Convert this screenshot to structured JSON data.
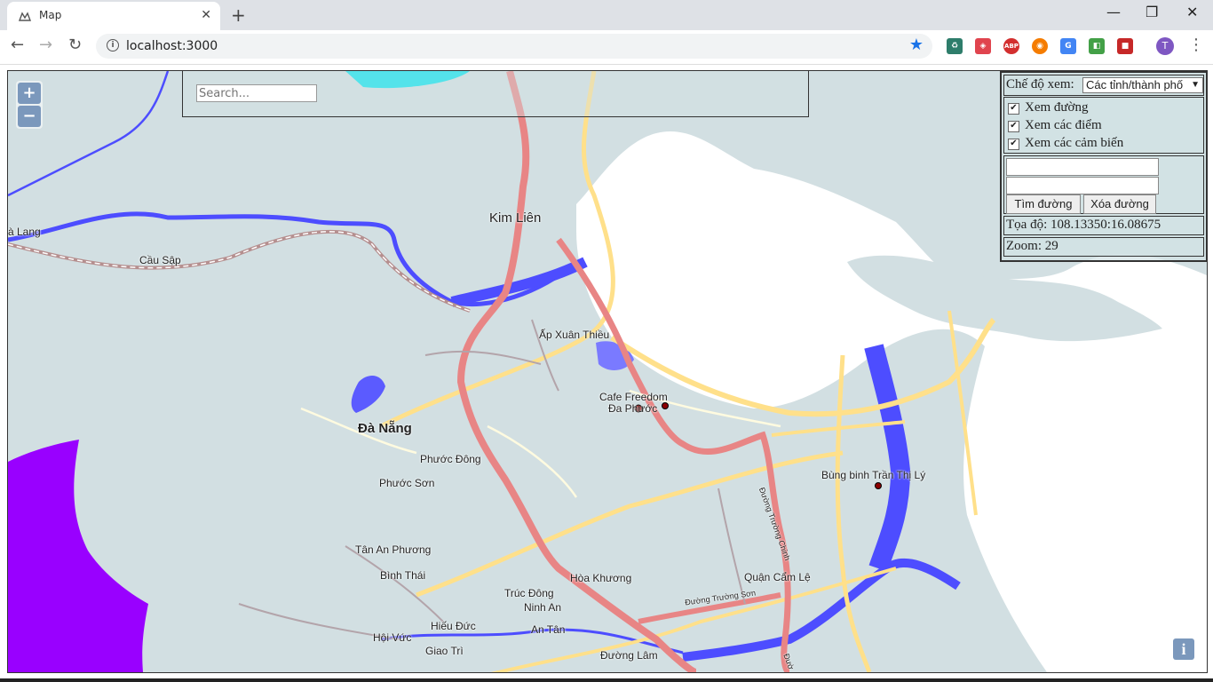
{
  "browser": {
    "tab_title": "Map",
    "tab_close": "✕",
    "new_tab": "+",
    "url": "localhost:3000",
    "avatar_letter": "T",
    "window_controls": {
      "minimize": "—",
      "maximize": "❐",
      "close": "✕"
    },
    "nav": {
      "back": "←",
      "forward": "→",
      "reload": "↻"
    },
    "extensions": [
      {
        "name": "recycle-icon",
        "color": "#2e7d6b",
        "text": "♻"
      },
      {
        "name": "shield-icon",
        "color": "#e0444e",
        "text": "◈"
      },
      {
        "name": "abp-icon",
        "color": "#d32f2f",
        "text": "ABP"
      },
      {
        "name": "orange-extension-icon",
        "color": "#f57c00",
        "text": "◉"
      },
      {
        "name": "translate-icon",
        "color": "#4285f4",
        "text": "G"
      },
      {
        "name": "green-extension-icon",
        "color": "#43a047",
        "text": "◧"
      },
      {
        "name": "red-extension-icon",
        "color": "#c62828",
        "text": "■"
      }
    ]
  },
  "map": {
    "zoom_in": "+",
    "zoom_out": "−",
    "search_placeholder": "Search...",
    "info_button": "i",
    "labels": {
      "kim_lien": "Kim Liên",
      "a_lang": "à Lang",
      "cau_sap": "Cầu Sập",
      "ap_xuan_thieu": "Ấp Xuân Thiều",
      "cafe_freedom": "Cafe Freedom",
      "da_phuoc": "Đa Phước",
      "da_nang": "Đà Nẵng",
      "phuoc_dong": "Phước Đông",
      "phuoc_son": "Phước Sơn",
      "tan_an_phuong": "Tân An Phương",
      "binh_thai": "Bình Thái",
      "truc_dong": "Trúc Đông",
      "ninh_an": "Ninh An",
      "hoa_khuong": "Hòa Khương",
      "quan_cam_le": "Quận Cẩm Lệ",
      "bung_binh": "Bùng binh Trần Thị Lý",
      "hoi_vuc": "Hội Vức",
      "hieu_duc": "Hiếu Đức",
      "an_tan": "An Tân",
      "giao_tri": "Giao Trì",
      "duong_lam": "Đường Lâm",
      "duong_truong_son": "Đường Trường Sơn",
      "duong_truong_chinh": "Đường Trường Chinh",
      "duong_short": "Đườ"
    }
  },
  "panel": {
    "view_mode_label": "Chế độ xem:",
    "view_mode_value": "Các tỉnh/thành phố",
    "checkboxes": [
      {
        "label": "Xem đường",
        "checked": true
      },
      {
        "label": "Xem các điểm",
        "checked": true
      },
      {
        "label": "Xem các cảm biến",
        "checked": true
      }
    ],
    "find_route_button": "Tìm đường",
    "clear_route_button": "Xóa đường",
    "coords_label": "Tọa độ: 108.13350:16.08675",
    "zoom_label": "Zoom: 29"
  }
}
